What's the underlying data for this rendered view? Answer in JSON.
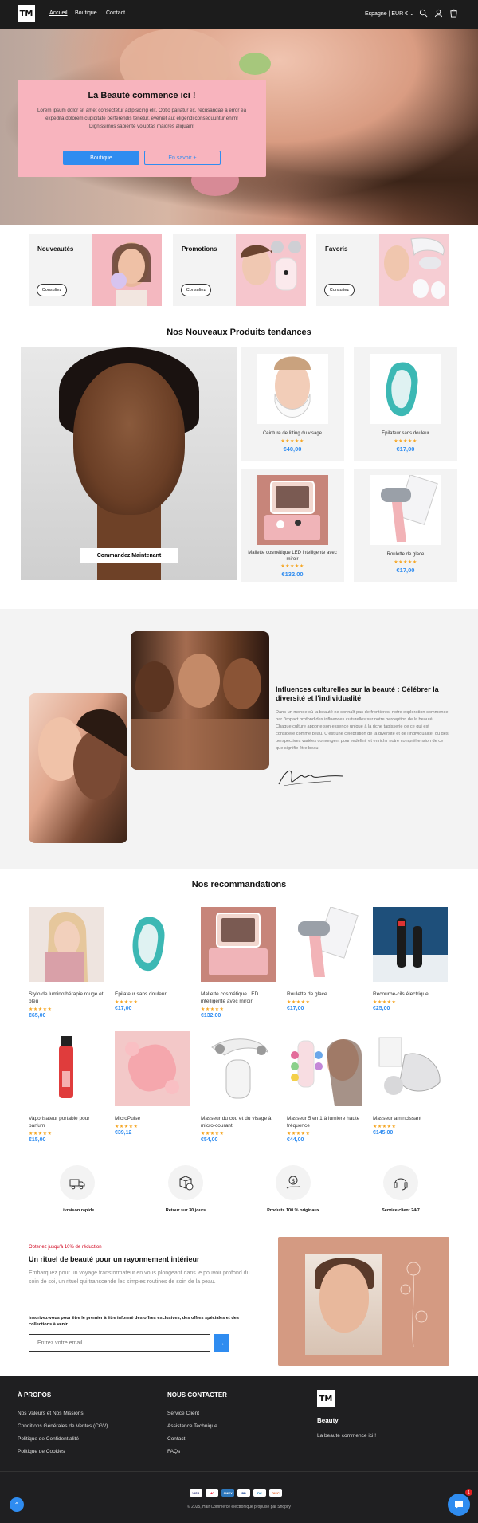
{
  "header": {
    "logo": "TM",
    "nav": [
      "Accueil",
      "Boutique",
      "Contact"
    ],
    "locale": "Espagne | EUR €"
  },
  "hero": {
    "title": "La Beauté commence ici !",
    "text": "Lorem ipsum dolor sit amet consectetur adipisicing elit. Optio pariatur ex, recusandae a error ea expedita dolorem cupiditate perferendis tenetur, eveniet aut eligendi consequuntur enim! Dignissimos sapiente voluptas maiores aliquam!",
    "primary_button": "Boutique",
    "secondary_button": "En savoir +"
  },
  "collections": [
    {
      "title": "Nouveautés",
      "button": "Consultez"
    },
    {
      "title": "Promotions",
      "button": "Consultez"
    },
    {
      "title": "Favoris",
      "button": "Consultez"
    }
  ],
  "trending": {
    "title": "Nos Nouveaux Produits tendances",
    "big_button": "Commandez Maintenant",
    "products": [
      {
        "name": "Ceinture de lifting du visage",
        "stars": "★★★★★",
        "price": "€40,00"
      },
      {
        "name": "Épilateur sans douleur",
        "stars": "★★★★★",
        "price": "€17,00"
      },
      {
        "name": "Mallette cosmétique LED intelligente avec miroir",
        "stars": "★★★★★",
        "price": "€132,00"
      },
      {
        "name": "Roulette de glace",
        "stars": "★★★★★",
        "price": "€17,00"
      }
    ]
  },
  "culture": {
    "title": "Influences culturelles sur la beauté : Célébrer la diversité et l'individualité",
    "text": "Dans un monde où la beauté ne connaît pas de frontières, notre exploration commence par l'impact profond des influences culturelles sur notre perception de la beauté. Chaque culture apporte son essence unique à la riche tapisserie de ce qui est considéré comme beau. C'est une célébration de la diversité et de l'individualité, où des perspectives variées convergent pour redéfinir et enrichir notre compréhension de ce que signifie être beau."
  },
  "recommendations": {
    "title": "Nos recommandations",
    "products": [
      {
        "name": "Stylo de luminothérapie rouge et bleu",
        "stars": "★★★★★",
        "price": "€65,00"
      },
      {
        "name": "Épilateur sans douleur",
        "stars": "★★★★★",
        "price": "€17,00"
      },
      {
        "name": "Mallette cosmétique LED intelligente avec miroir",
        "stars": "★★★★★",
        "price": "€132,00"
      },
      {
        "name": "Roulette de glace",
        "stars": "★★★★★",
        "price": "€17,00"
      },
      {
        "name": "Recourbe-cils électrique",
        "stars": "★★★★★",
        "price": "€25,00"
      },
      {
        "name": "Vaporisateur portable pour parfum",
        "stars": "★★★★★",
        "price": "€15,00"
      },
      {
        "name": "MicroPulse",
        "stars": "★★★★★",
        "price": "€39,12"
      },
      {
        "name": "Masseur du cou et du visage à micro-courant",
        "stars": "★★★★★",
        "price": "€54,00"
      },
      {
        "name": "Masseur 5 en 1 à lumière haute fréquence",
        "stars": "★★★★★",
        "price": "€44,00"
      },
      {
        "name": "Masseur amincissant",
        "stars": "★★★★★",
        "price": "€145,00"
      }
    ]
  },
  "features": [
    "Livraison rapide",
    "Retour sur 30 jours",
    "Produits 100 % originaux",
    "Service client 24/7"
  ],
  "newsletter": {
    "promo": "Obtenez jusqu'à 10% de réduction",
    "title": "Un rituel de beauté pour un rayonnement intérieur",
    "text": "Embarquez pour un voyage transformateur en vous plongeant dans le pouvoir profond du soin de soi, un rituel qui transcende les simples routines de soin de la peau.",
    "small": "Inscrivez-vous pour être le premier à être informé des offres exclusives, des offres spéciales et des collections à venir",
    "placeholder": "Entrez votre email"
  },
  "footer": {
    "about_title": "À PROPOS",
    "about_links": [
      "Nos Valeurs et Nos Missions",
      "Conditions Générales de Ventes (CGV)",
      "Politique de Confidentialité",
      "Politique de Cookies"
    ],
    "contact_title": "NOUS CONTACTER",
    "contact_links": [
      "Service Client",
      "Assistance Technique",
      "Contact",
      "FAQs"
    ],
    "logo": "TM",
    "brand_title": "Beauty",
    "brand_tagline": "La beauté commence ici !",
    "payments": [
      "VISA",
      "MC",
      "AMEX",
      "PP",
      "DC",
      "DISC"
    ],
    "copyright": "© 2025, Hair Commerce électronique propulsé par Shopify",
    "chat_badge": "1"
  },
  "colors": {
    "accent": "#2f8cf0",
    "hero_box": "#f8b4be",
    "footer": "#1f1f21",
    "stars": "#f5a623"
  }
}
